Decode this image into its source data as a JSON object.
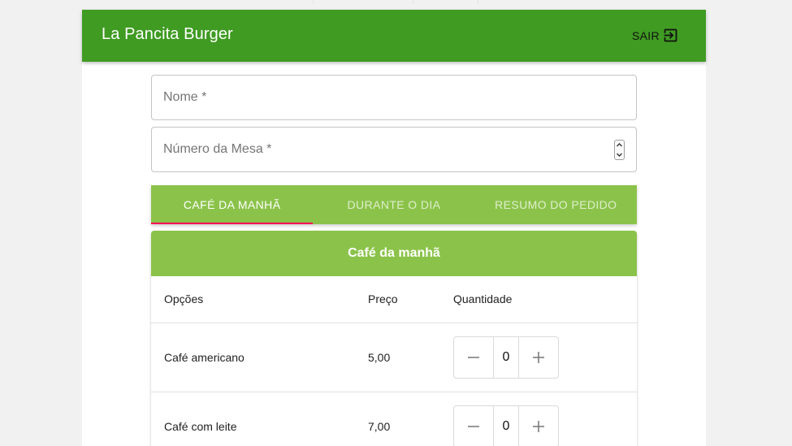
{
  "appbar": {
    "title": "La Pancita Burger",
    "logout_label": "SAIR",
    "logout_icon": "exit-to-app-icon",
    "color": "#3f9b22"
  },
  "form": {
    "name_placeholder": "Nome *",
    "table_placeholder": "Número da Mesa *"
  },
  "tabs": [
    {
      "label": "CAFÉ DA MANHÃ",
      "active": true
    },
    {
      "label": "DURANTE O DIA",
      "active": false
    },
    {
      "label": "RESUMO DO PEDIDO",
      "active": false
    }
  ],
  "tab_accent": "#8bc34a",
  "tab_indicator_color": "#f50057",
  "menu": {
    "title": "Café da manhã",
    "columns": [
      "Opções",
      "Preço",
      "Quantidade"
    ],
    "rows": [
      {
        "name": "Café americano",
        "price": "5,00",
        "quantity": "0"
      },
      {
        "name": "Café com leite",
        "price": "7,00",
        "quantity": "0"
      }
    ]
  }
}
